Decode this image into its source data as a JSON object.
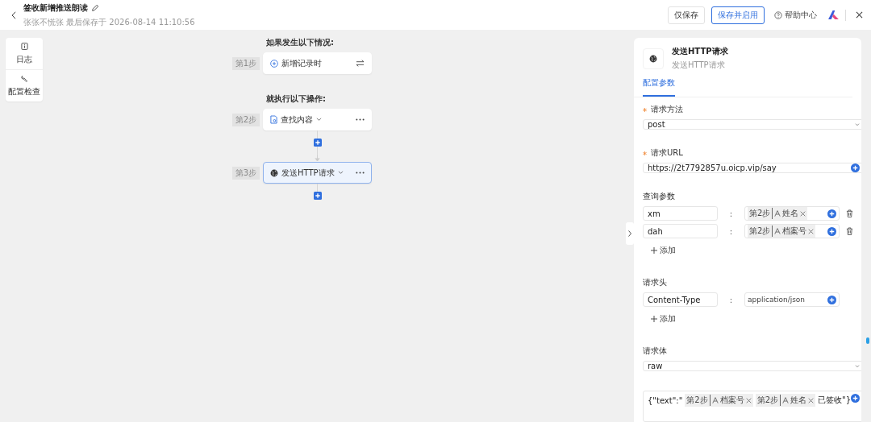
{
  "header": {
    "title": "签收新增推送朗读",
    "subtitle": "张张不慌张 最后保存于 2026-08-14 11:10:56",
    "buttons": [
      {
        "label": "仅保存",
        "kind": "default"
      },
      {
        "label": "保存并启用",
        "kind": "primary"
      }
    ],
    "help": "帮助中心"
  },
  "toolbar": [
    {
      "label": "日志",
      "kind": "log"
    },
    {
      "label": "配置检查",
      "kind": "check"
    }
  ],
  "flow": {
    "trigger_heading": "如果发生以下情况:",
    "trigger": {
      "step": "第1步",
      "title": "新增记录时",
      "selected": false
    },
    "action_heading": "就执行以下操作:",
    "actions": [
      {
        "step": "第2步",
        "title": "查找内容",
        "kind": "find",
        "selected": false
      },
      {
        "step": "第3步",
        "title": "发送HTTP请求",
        "kind": "http",
        "selected": true
      }
    ]
  },
  "panel": {
    "title": "发送HTTP请求",
    "subtitle": "发送HTTP请求",
    "tabs": [
      {
        "label": "配置参数",
        "selected": true
      }
    ],
    "method": {
      "label": "请求方法",
      "required": true,
      "value": "post"
    },
    "url": {
      "label": "请求URL",
      "required": true,
      "value": "https://2t7792857u.oicp.vip/say"
    },
    "query": {
      "label": "查询参数",
      "rows": [
        {
          "key": "xm",
          "separator": ":",
          "chips": [
            {
              "step": "第2步",
              "field": "姓名"
            }
          ]
        },
        {
          "key": "dah",
          "separator": ":",
          "chips": [
            {
              "step": "第2步",
              "field": "档案号"
            }
          ]
        }
      ],
      "add": "添加"
    },
    "headers": {
      "label": "请求头",
      "rows": [
        {
          "key": "Content-Type",
          "separator": ":",
          "value": "application/json"
        }
      ],
      "add": "添加"
    },
    "body_type": {
      "label": "请求体",
      "value": "raw"
    },
    "body": [
      {
        "kind": "text",
        "text": "{\"text\":\""
      },
      {
        "kind": "chip",
        "step": "第2步",
        "field": "档案号"
      },
      {
        "kind": "chip",
        "step": "第2步",
        "field": "姓名"
      },
      {
        "kind": "text",
        "text": "已签收\"}"
      }
    ]
  }
}
